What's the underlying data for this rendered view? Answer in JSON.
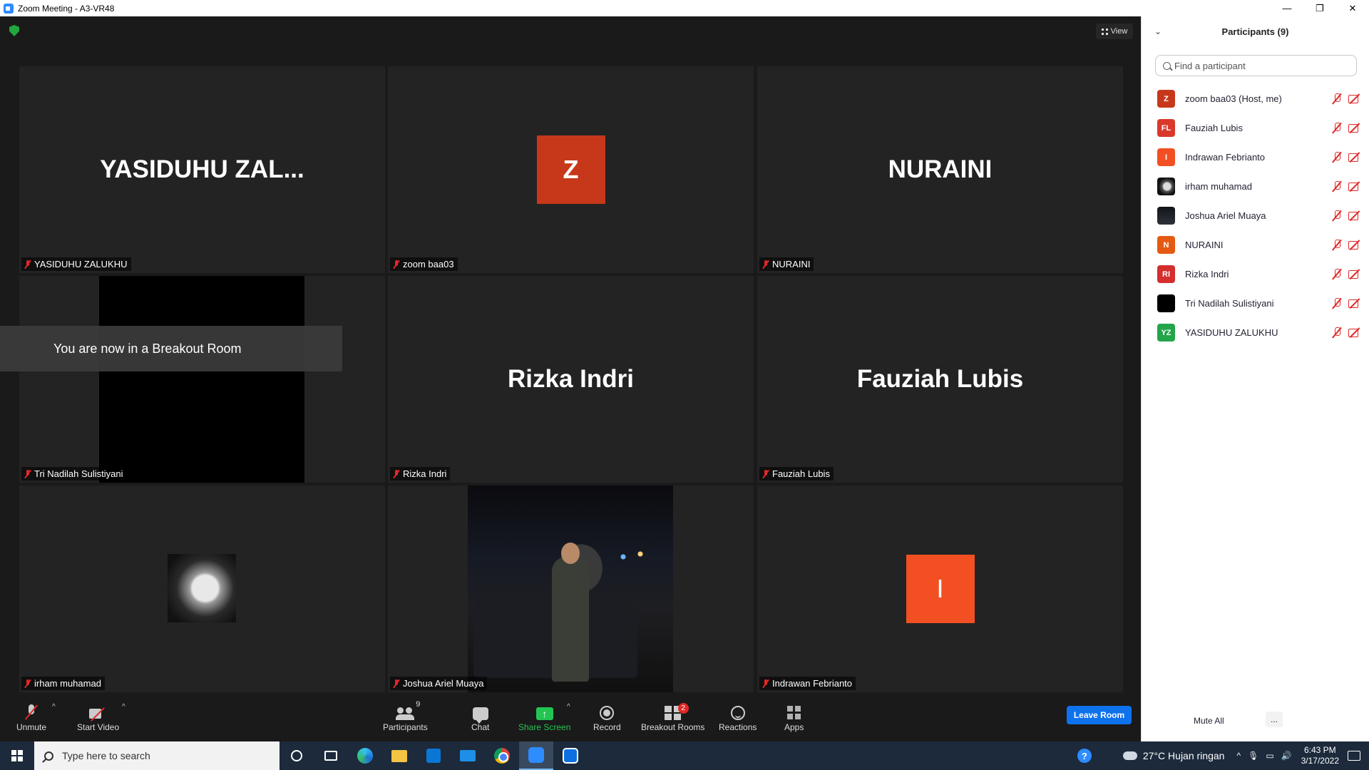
{
  "window": {
    "title": "Zoom Meeting - A3-VR48",
    "minimize": "—",
    "restore": "❐",
    "close": "✕"
  },
  "meeting": {
    "view_label": "View",
    "toast": "You are now in a Breakout Room",
    "tiles": [
      {
        "display": "YASIDUHU  ZAL...",
        "label": "YASIDUHU ZALUKHU",
        "kind": "text"
      },
      {
        "display": "Z",
        "label": "zoom baa03",
        "kind": "avatar",
        "color": "#C7381B"
      },
      {
        "display": "NURAINI",
        "label": "NURAINI",
        "kind": "text"
      },
      {
        "display": "",
        "label": "Tri Nadilah Sulistiyani",
        "kind": "black-video"
      },
      {
        "display": "Rizka Indri",
        "label": "Rizka Indri",
        "kind": "text"
      },
      {
        "display": "Fauziah Lubis",
        "label": "Fauziah Lubis",
        "kind": "text"
      },
      {
        "display": "",
        "label": "irham muhamad",
        "kind": "photo"
      },
      {
        "display": "",
        "label": "Joshua Ariel Muaya",
        "kind": "video"
      },
      {
        "display": "I",
        "label": "Indrawan Febrianto",
        "kind": "avatar",
        "color": "#F25022"
      }
    ]
  },
  "toolbar": {
    "unmute": "Unmute",
    "start_video": "Start Video",
    "participants": "Participants",
    "participants_count": "9",
    "chat": "Chat",
    "share_screen": "Share Screen",
    "record": "Record",
    "breakout_rooms": "Breakout Rooms",
    "breakout_badge": "2",
    "reactions": "Reactions",
    "apps": "Apps",
    "leave_room": "Leave Room",
    "caret": "^"
  },
  "panel": {
    "title": "Participants (9)",
    "search_placeholder": "Find a participant",
    "mute_all": "Mute All",
    "more": "...",
    "participants": [
      {
        "initials": "Z",
        "name": "zoom baa03 (Host, me)",
        "color": "#C7381B"
      },
      {
        "initials": "FL",
        "name": "Fauziah Lubis",
        "color": "#D9382B"
      },
      {
        "initials": "I",
        "name": "Indrawan Febrianto",
        "color": "#F25022"
      },
      {
        "initials": "",
        "name": "irham muhamad",
        "color": "#2b2b2b"
      },
      {
        "initials": "",
        "name": "Joshua Ariel Muaya",
        "color": "#1e2228"
      },
      {
        "initials": "N",
        "name": "NURAINI",
        "color": "#E55A12"
      },
      {
        "initials": "RI",
        "name": "Rizka Indri",
        "color": "#D42E2E"
      },
      {
        "initials": "",
        "name": "Tri Nadilah Sulistiyani",
        "color": "#000000"
      },
      {
        "initials": "YZ",
        "name": "YASIDUHU ZALUKHU",
        "color": "#23A54A"
      }
    ]
  },
  "taskbar": {
    "search_placeholder": "Type here to search",
    "help": "?",
    "weather": "27°C  Hujan ringan",
    "tray_chevron": "^",
    "time": "6:43 PM",
    "date": "3/17/2022"
  }
}
